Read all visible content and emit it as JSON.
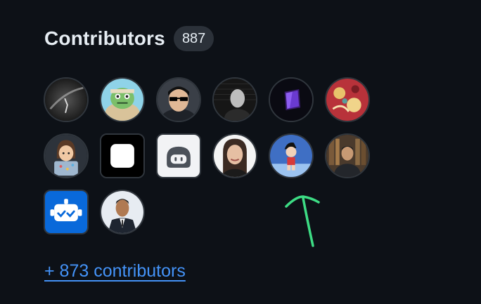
{
  "contributors": {
    "title": "Contributors",
    "count": "887",
    "more_link_label": "+ 873 contributors",
    "avatars": [
      {
        "kind": "photo",
        "shape": "round",
        "subject": "dark-abstract"
      },
      {
        "kind": "illustration",
        "shape": "round",
        "subject": "green-cartoon-character"
      },
      {
        "kind": "photo",
        "shape": "round",
        "subject": "person-with-sunglasses"
      },
      {
        "kind": "photo",
        "shape": "round",
        "subject": "person-dark-studio"
      },
      {
        "kind": "graphic",
        "shape": "round",
        "subject": "purple-device"
      },
      {
        "kind": "illustration",
        "shape": "round",
        "subject": "red-floral-art"
      },
      {
        "kind": "illustration",
        "shape": "round",
        "subject": "person-with-laptop"
      },
      {
        "kind": "graphic",
        "shape": "square",
        "subject": "white-rounded-square"
      },
      {
        "kind": "graphic",
        "shape": "square",
        "subject": "copilot-logo"
      },
      {
        "kind": "photo",
        "shape": "round",
        "subject": "smiling-woman"
      },
      {
        "kind": "illustration",
        "shape": "round",
        "subject": "cartoon-boy-blue-sky"
      },
      {
        "kind": "photo",
        "shape": "round",
        "subject": "person-bookshelf"
      },
      {
        "kind": "graphic",
        "shape": "square",
        "subject": "dependabot-logo"
      },
      {
        "kind": "photo",
        "shape": "round",
        "subject": "man-in-suit"
      }
    ]
  },
  "annotation": {
    "type": "hand-drawn-arrow",
    "color": "#3ddc84",
    "points_to": "avatar-11"
  },
  "colors": {
    "background": "#0d1117",
    "text": "#e6edf3",
    "badge_bg": "#2b3139",
    "link": "#4493f8"
  }
}
